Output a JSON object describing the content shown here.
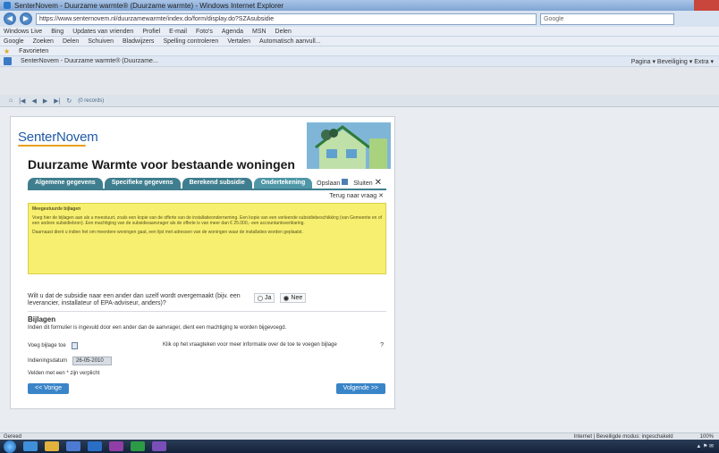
{
  "browser": {
    "window_title": "SenterNovem - Duurzame warmte® (Duurzame warmte) - Windows Internet Explorer",
    "url": "https://www.senternovem.nl/duurzamewarmte/index.do/form/display.do?SZAsubsidie",
    "search_placeholder": "Google",
    "toolbar1": [
      "Windows Live",
      "Bing",
      "Updates van vrienden",
      "Profiel",
      "E-mail",
      "Foto's",
      "Agenda",
      "MSN",
      "Delen"
    ],
    "toolbar2": [
      "Google",
      "Zoeken",
      "Delen",
      "Schuiven",
      "Bladwijzers",
      "Spelling controleren",
      "Vertalen",
      "Automatisch aanvull..."
    ],
    "favorites": "Favorieten",
    "tab_title": "SenterNovem - Duurzame warmte® (Duurzame...",
    "page_tools": "Pagina ▾  Beveiliging ▾  Extra ▾",
    "app_toolbar_hint": "(0 records)"
  },
  "page": {
    "logo": "SenterNovem",
    "title": "Duurzame Warmte voor bestaande woningen",
    "tabs": [
      {
        "label": "Algemene gegevens",
        "active": false
      },
      {
        "label": "Specifieke gegevens",
        "active": false
      },
      {
        "label": "Berekend subsidie",
        "active": false
      },
      {
        "label": "Ondertekening",
        "active": true
      }
    ],
    "save_label": "Opslaan",
    "close_label": "Sluiten",
    "back_link": "Terug naar vraag",
    "help": {
      "heading": "Meegestuurde bijlagen",
      "p1": "Voeg hier de bijlagen aan als u meestuurt, zoals een kopie van de offerte van de installatieonderneming. Een kopie van een verleende subsidiebeschikking (van Gemeente en of een andere subsidiebron). Een machtiging van de subsidieaanvrager als de offerte is van meer dan € 25.000,- een accountantsverklaring.",
      "p2": "Daarnaast dient u indien het om meerdere woningen gaat, een lijst met adressen van de woningen waar de installaties worden geplaatst."
    },
    "question": "Wilt u dat de subsidie naar een ander dan uzelf wordt overgemaakt (bijv. een leverancier, installateur of EPA-adviseur, anders)?",
    "radio_yes": "Ja",
    "radio_no": "Nee",
    "attachments_title": "Bijlagen",
    "attachments_text": "Indien dit formulier is ingevuld door een ander dan de aanvrager, dient een machtiging te worden bijgevoegd.",
    "add_attachment": "Voeg bijlage toe",
    "info_text": "Klik op het vraagteken voor meer informatie over de toe te voegen bijlage",
    "info_q": "?",
    "date_label": "Indieningsdatum",
    "date_value": "26-05-2010",
    "required_note": "Velden met een * zijn verplicht",
    "prev_button": "<< Vorige",
    "next_button": "Volgende >>"
  },
  "status": {
    "left": "Gereed",
    "zone": "Internet | Beveiligde modus: ingeschakeld",
    "zoom": "100%"
  }
}
